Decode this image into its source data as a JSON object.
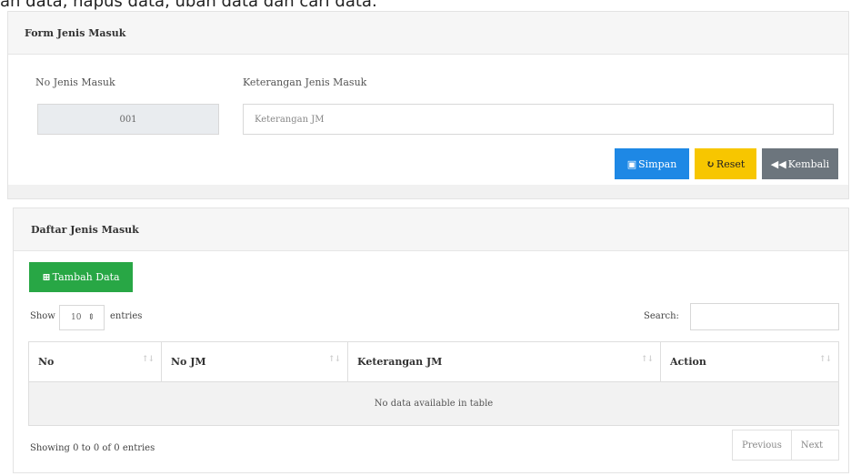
{
  "intro_text": "ah data, hapus data, ubah data dan cari data.",
  "form_panel": {
    "title": "Form Jenis Masuk",
    "no_label": "No Jenis Masuk",
    "no_value": "001",
    "ket_label": "Keterangan Jenis Masuk",
    "ket_placeholder": "Keterangan JM",
    "buttons": {
      "simpan": "Simpan",
      "reset": "Reset",
      "kembali": "Kembali"
    }
  },
  "list_panel": {
    "title": "Daftar Jenis Masuk",
    "add_button": "Tambah Data",
    "show_label": "Show",
    "entries_value": "10",
    "entries_label": "entries",
    "search_label": "Search:",
    "columns": [
      "No",
      "No JM",
      "Keterangan JM",
      "Action"
    ],
    "empty_message": "No data available in table",
    "info": "Showing 0 to 0 of 0 entries",
    "pager": {
      "previous": "Previous",
      "next": "Next"
    }
  },
  "colors": {
    "primary": "#1e88e5",
    "warning": "#f7c600",
    "secondary": "#6c757d",
    "success": "#28a745"
  },
  "icons": [
    "save-icon",
    "refresh-icon",
    "back-icon",
    "plus-square-icon",
    "sort-icon"
  ]
}
